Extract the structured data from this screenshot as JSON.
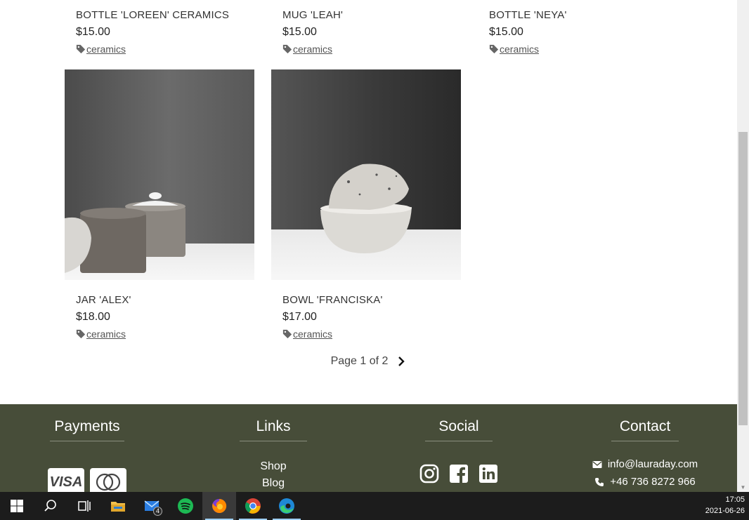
{
  "products_top": [
    {
      "name": "BOTTLE 'LOREEN' CERAMICS",
      "price": "$15.00",
      "tag": "ceramics"
    },
    {
      "name": "MUG 'LEAH'",
      "price": "$15.00",
      "tag": "ceramics"
    },
    {
      "name": "BOTTLE 'NEYA'",
      "price": "$15.00",
      "tag": "ceramics"
    }
  ],
  "products_bottom": [
    {
      "name": "JAR 'ALEX'",
      "price": "$18.00",
      "tag": "ceramics"
    },
    {
      "name": "BOWL 'FRANCISKA'",
      "price": "$17.00",
      "tag": "ceramics"
    }
  ],
  "pagination": {
    "text": "Page 1 of 2"
  },
  "footer": {
    "payments": {
      "title": "Payments",
      "cards": [
        "VISA",
        "mastercard"
      ]
    },
    "links": {
      "title": "Links",
      "items": [
        "Shop",
        "Blog"
      ]
    },
    "social": {
      "title": "Social",
      "icons": [
        "instagram-icon",
        "facebook-icon",
        "linkedin-icon"
      ]
    },
    "contact": {
      "title": "Contact",
      "email": "info@lauraday.com",
      "phone": "+46 736 8272 966"
    },
    "background_color": "#474d39"
  },
  "taskbar": {
    "apps": [
      "start-icon",
      "search-icon",
      "task-view-icon",
      "file-explorer-icon",
      "mail-icon",
      "spotify-icon",
      "firefox-icon",
      "chrome-icon",
      "edge-icon"
    ],
    "mail_badge": "4",
    "time": "17:05",
    "date": "2021-06-26"
  }
}
